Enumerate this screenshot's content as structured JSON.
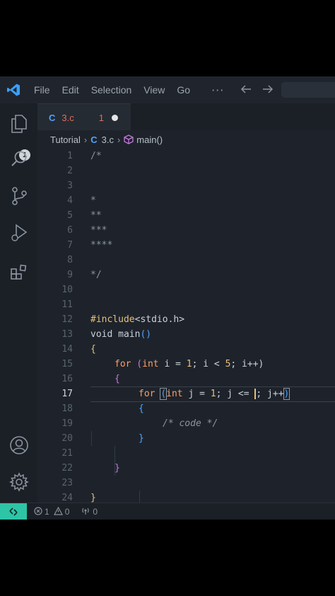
{
  "menu": {
    "file": "File",
    "edit": "Edit",
    "selection": "Selection",
    "view": "View",
    "go": "Go",
    "more": "···"
  },
  "tab": {
    "icon": "C",
    "name": "3.c",
    "problems": "1"
  },
  "breadcrumb": {
    "folder": "Tutorial",
    "file_icon": "C",
    "file": "3.c",
    "symbol": "main()"
  },
  "activity": {
    "explorer_badge": "1"
  },
  "editor": {
    "active_line": 17,
    "line_numbers": [
      "1",
      "2",
      "3",
      "4",
      "5",
      "6",
      "7",
      "8",
      "9",
      "10",
      "11",
      "12",
      "13",
      "14",
      "15",
      "16",
      "17",
      "18",
      "19",
      "20",
      "21",
      "22",
      "23",
      "24"
    ],
    "lines": {
      "l1": "/*",
      "l4": "*",
      "l5": "**",
      "l6": "***",
      "l7": "****",
      "l9": "*/",
      "l12_a": "#include",
      "l12_b": "<stdio.h>",
      "l13_a": "void",
      "l13_b": " main",
      "l13_c": "()",
      "l14": "{",
      "l15_for": "for",
      "l15_rest1": " (",
      "l15_int": "int",
      "l15_rest2": " i = ",
      "l15_n1": "1",
      "l15_rest3": "; i < ",
      "l15_n2": "5",
      "l15_rest4": "; i++)",
      "l16": "{",
      "l17_for": "for",
      "l17_sp": " ",
      "l17_open": "(",
      "l17_int": "int",
      "l17_r1": " j = ",
      "l17_n1": "1",
      "l17_r2": "; j <= ",
      "l17_r3": "; j++",
      "l17_close": ")",
      "l18": "{",
      "l19": "/* code */",
      "l20": "}",
      "l22": "}",
      "l24": "}"
    }
  },
  "status": {
    "remote": "><",
    "errors": "1",
    "warnings": "0",
    "ports": "0"
  },
  "colors": {
    "accent": "#2ec4a6",
    "tab_name": "#e06c5a",
    "c_icon": "#4fa3ff",
    "keyword": "#ff9e64"
  }
}
